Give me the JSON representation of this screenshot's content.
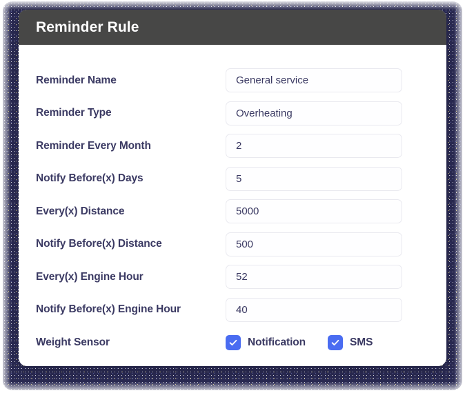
{
  "card": {
    "header": {
      "title": "Reminder Rule"
    },
    "fields": [
      {
        "label": "Reminder Name",
        "value": "General service"
      },
      {
        "label": "Reminder Type",
        "value": "Overheating"
      },
      {
        "label": "Reminder Every Month",
        "value": "2"
      },
      {
        "label": "Notify Before(x) Days",
        "value": "5"
      },
      {
        "label": "Every(x) Distance",
        "value": "5000"
      },
      {
        "label": "Notify Before(x) Distance",
        "value": "500"
      },
      {
        "label": "Every(x) Engine Hour",
        "value": "52"
      },
      {
        "label": "Notify Before(x) Engine Hour",
        "value": "40"
      }
    ],
    "checkbox_row": {
      "label": "Weight Sensor",
      "options": [
        {
          "label": "Notification",
          "checked": true,
          "icon": "check-icon"
        },
        {
          "label": "SMS",
          "checked": true,
          "icon": "check-icon"
        }
      ]
    }
  },
  "colors": {
    "header_bg": "#474746",
    "header_text": "#ffffff",
    "label_text": "#3b3a63",
    "input_border": "#e9e9ef",
    "input_bg": "#fefeff",
    "checkbox_accent": "#4a6cf1",
    "backdrop": "#2a2a52",
    "page_bg": "#ffffff"
  }
}
